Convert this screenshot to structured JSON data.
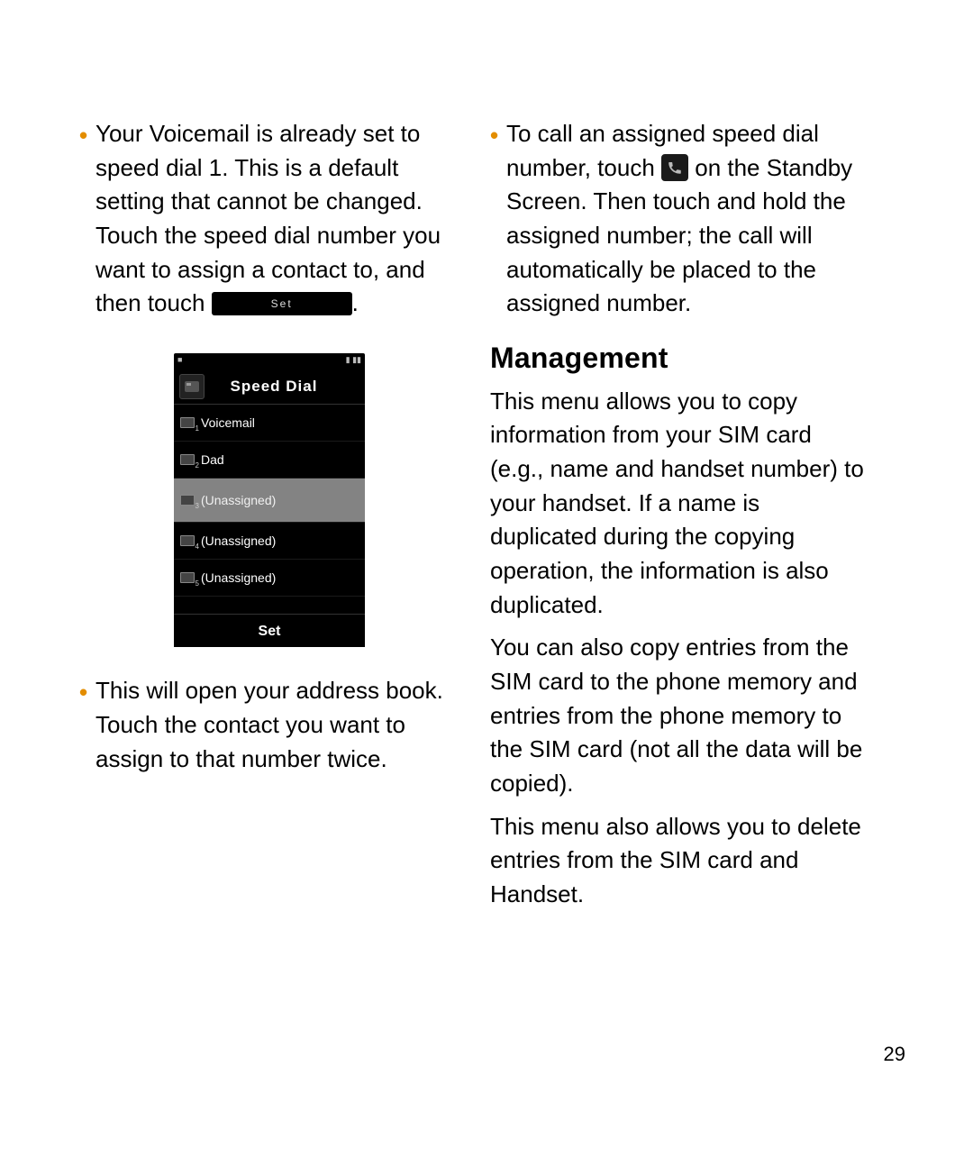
{
  "col_left": {
    "bullet1_part1": "Your Voicemail is already set to speed dial 1. This is a default setting that cannot be changed. Touch the speed dial number you want to assign a contact to, and then touch ",
    "bullet1_part2": ".",
    "set_button_label": "Set",
    "bullet2": "This will open your address book. Touch the contact you want to assign to that number twice."
  },
  "phone_ui": {
    "status_left": "■",
    "status_right": "▮ ▮▮",
    "title": "Speed Dial",
    "rows": [
      {
        "idx": "1",
        "label": "Voicemail",
        "selected": false
      },
      {
        "idx": "2",
        "label": "Dad",
        "selected": false
      },
      {
        "idx": "3",
        "label": "(Unassigned)",
        "selected": true
      },
      {
        "idx": "4",
        "label": "(Unassigned)",
        "selected": false
      },
      {
        "idx": "5",
        "label": "(Unassigned)",
        "selected": false
      }
    ],
    "bottom_button": "Set"
  },
  "col_right": {
    "bullet1_part1": "To call an assigned speed dial number, touch ",
    "bullet1_part2": " on the Standby Screen. Then touch and hold the assigned number; the call will automatically be placed to the assigned number.",
    "heading": "Management",
    "p1": "This menu allows you to copy information from your SIM card (e.g., name and handset number) to your handset. If a name is duplicated during the copying operation, the information is also duplicated.",
    "p2": "You can also copy entries from the SIM card to the phone memory and entries from the phone memory to the SIM card (not all the data will be copied).",
    "p3": "This menu also allows you to delete entries from the SIM card and Handset."
  },
  "page_number": "29"
}
